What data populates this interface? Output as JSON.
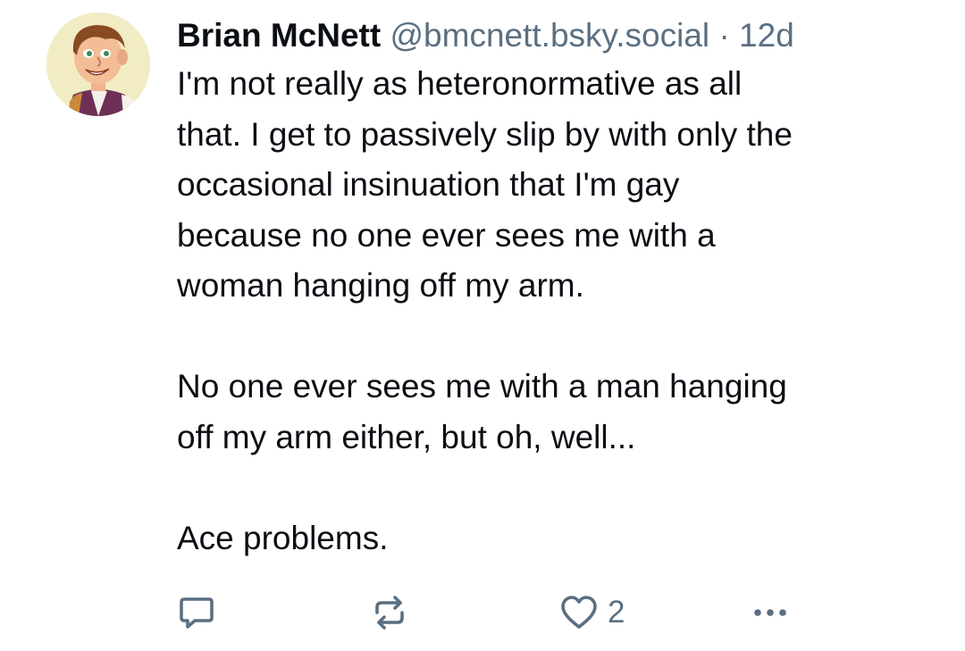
{
  "post": {
    "author": {
      "display_name": "Brian McNett",
      "handle": "@bmcnett.bsky.social",
      "separator": "·",
      "age": "12d"
    },
    "text": "I'm not really as heteronormative as all\nthat. I get to passively slip by with only the\noccasional insinuation that I'm gay\nbecause no one ever sees me with a\nwoman hanging off my arm.\n\nNo one ever sees me with a man hanging\noff my arm either, but oh, well...\n\nAce problems.",
    "actions": {
      "like_count": "2"
    }
  },
  "icons": {
    "avatar": "cartoon-avatar",
    "reply": "speech-bubble-icon",
    "repost": "repost-arrows-icon",
    "like": "heart-outline-icon",
    "more": "ellipsis-icon"
  },
  "colors": {
    "text": "#0b0f14",
    "muted": "#5b6f82",
    "background": "#ffffff"
  }
}
